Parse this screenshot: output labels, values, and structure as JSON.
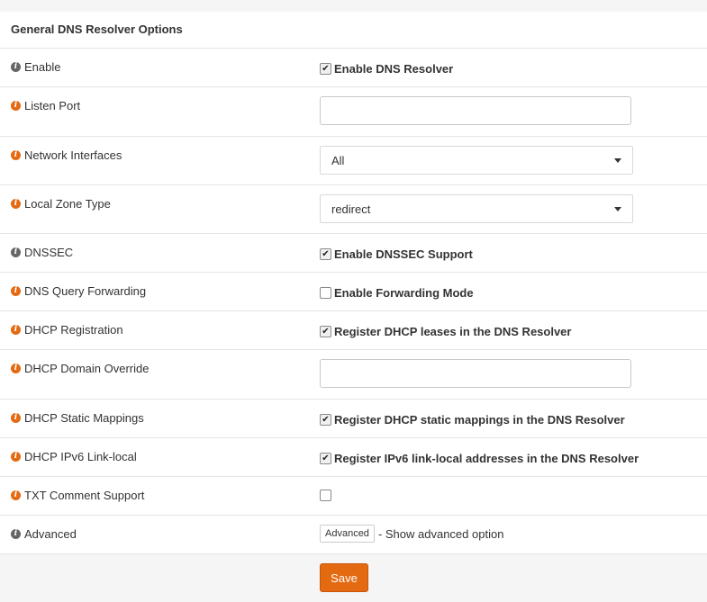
{
  "panel": {
    "title": "General DNS Resolver Options"
  },
  "colors": {
    "accent": "#e46a12",
    "info_gray": "#666666",
    "info_orange": "#e46a12"
  },
  "rows": [
    {
      "label": "Enable",
      "icon_color": "gray",
      "control": "checkbox",
      "checked": true,
      "text": "Enable DNS Resolver"
    },
    {
      "label": "Listen Port",
      "icon_color": "orange",
      "control": "input",
      "value": "",
      "placeholder": ""
    },
    {
      "label": "Network Interfaces",
      "icon_color": "orange",
      "control": "select",
      "value": "All"
    },
    {
      "label": "Local Zone Type",
      "icon_color": "orange",
      "control": "select",
      "value": "redirect"
    },
    {
      "label": "DNSSEC",
      "icon_color": "gray",
      "control": "checkbox",
      "checked": true,
      "text": "Enable DNSSEC Support"
    },
    {
      "label": "DNS Query Forwarding",
      "icon_color": "orange",
      "control": "checkbox",
      "checked": false,
      "text": "Enable Forwarding Mode"
    },
    {
      "label": "DHCP Registration",
      "icon_color": "orange",
      "control": "checkbox",
      "checked": true,
      "text": "Register DHCP leases in the DNS Resolver"
    },
    {
      "label": "DHCP Domain Override",
      "icon_color": "orange",
      "control": "input",
      "value": "",
      "placeholder": ""
    },
    {
      "label": "DHCP Static Mappings",
      "icon_color": "orange",
      "control": "checkbox",
      "checked": true,
      "text": "Register DHCP static mappings in the DNS Resolver"
    },
    {
      "label": "DHCP IPv6 Link-local",
      "icon_color": "orange",
      "control": "checkbox",
      "checked": true,
      "text": "Register IPv6 link-local addresses in the DNS Resolver"
    },
    {
      "label": "TXT Comment Support",
      "icon_color": "orange",
      "control": "checkbox",
      "checked": false,
      "text": ""
    },
    {
      "label": "Advanced",
      "icon_color": "gray",
      "control": "advanced",
      "button": "Advanced",
      "text": "- Show advanced option"
    }
  ],
  "save": {
    "label": "Save"
  }
}
